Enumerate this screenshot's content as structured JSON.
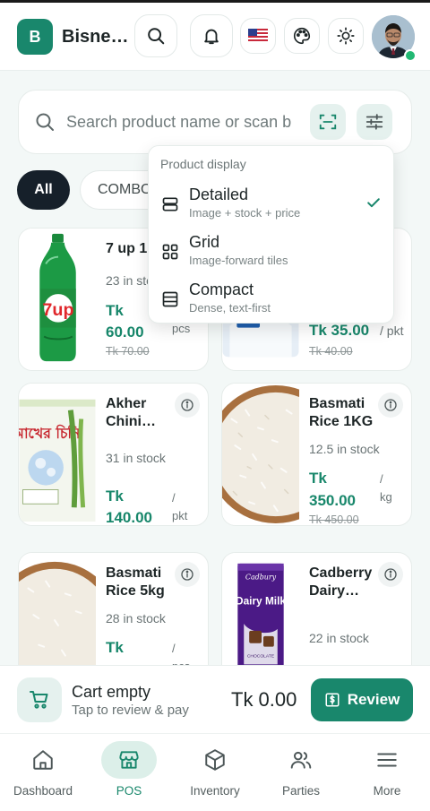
{
  "header": {
    "logo_letter": "B",
    "business_name": "Bisne…",
    "icons": [
      "search-icon",
      "bell-icon",
      "us-flag-icon",
      "palette-icon",
      "sun-icon"
    ]
  },
  "search": {
    "placeholder": "Search product name or scan b"
  },
  "filters": {
    "chips": [
      "All",
      "COMBO"
    ],
    "active": "All"
  },
  "display_menu": {
    "title": "Product display",
    "options": [
      {
        "label": "Detailed",
        "description": "Image + stock + price",
        "selected": true
      },
      {
        "label": "Grid",
        "description": "Image-forward tiles",
        "selected": false
      },
      {
        "label": "Compact",
        "description": "Dense, text-first",
        "selected": false
      }
    ]
  },
  "products": [
    {
      "name": "7 up 1L",
      "stock": "23 in stock",
      "currency": "Tk",
      "price": "60.00",
      "unit": "pcs",
      "old_price": "Tk 70.00"
    },
    {
      "name": "",
      "stock": "",
      "currency": "",
      "price": "Tk 35.00",
      "unit": "/ pkt",
      "old_price": "Tk 40.00"
    },
    {
      "name": "Akher Chini…",
      "stock": "31 in stock",
      "currency": "Tk",
      "price": "140.00",
      "unit_a": "/",
      "unit_b": "pkt"
    },
    {
      "name": "Basmati Rice 1KG",
      "stock": "12.5 in stock",
      "currency": "Tk",
      "price": "350.00",
      "unit_a": "/",
      "unit_b": "kg",
      "old_price": "Tk 450.00"
    },
    {
      "name": "Basmati Rice 5kg",
      "stock": "28 in stock",
      "currency": "Tk",
      "unit_a": "/",
      "unit_b": "pcs"
    },
    {
      "name": "Cadberry Dairy…",
      "stock": "22 in stock"
    }
  ],
  "image_text": {
    "bottle_logo": "7up",
    "bag_text": "আখের চিনি",
    "chocolate_brand": "Cadbury",
    "chocolate_name": "Dairy Milk",
    "chocolate_sub": "CHOCOLATE"
  },
  "cart": {
    "title": "Cart empty",
    "subtitle": "Tap to review & pay",
    "total": "Tk 0.00",
    "review_label": "Review"
  },
  "nav": {
    "items": [
      "Dashboard",
      "POS",
      "Inventory",
      "Parties",
      "More"
    ],
    "active": "POS"
  },
  "colors": {
    "accent": "#19876c",
    "price": "#18876b",
    "chip_active": "#16202a",
    "background": "#f3f8f7"
  }
}
